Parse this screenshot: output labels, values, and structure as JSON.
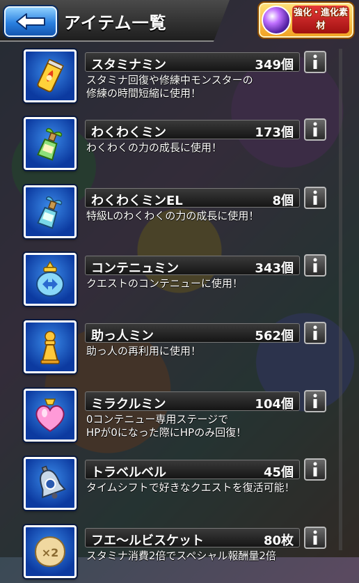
{
  "header": {
    "title": "アイテム一覧",
    "evolve_label": "強化・進化素材"
  },
  "items": [
    {
      "name": "スタミナミン",
      "count": "349個",
      "desc": "スタミナ回復や修練中モンスターの\n修練の時間短縮に使用！",
      "icon": "stamina-can-icon"
    },
    {
      "name": "わくわくミン",
      "count": "173個",
      "desc": "わくわくの力の成長に使用！",
      "icon": "sprout-bottle-icon"
    },
    {
      "name": "わくわくミンEL",
      "count": "8個",
      "desc": "特級Lのわくわくの力の成長に使用！",
      "icon": "sprout-bottle-el-icon"
    },
    {
      "name": "コンテニュミン",
      "count": "343個",
      "desc": "クエストのコンテニューに使用！",
      "icon": "continue-jar-icon"
    },
    {
      "name": "助っ人ミン",
      "count": "562個",
      "desc": "助っ人の再利用に使用！",
      "icon": "helper-pawn-icon"
    },
    {
      "name": "ミラクルミン",
      "count": "104個",
      "desc": "0コンテニュー専用ステージで\nHPが0になった際にHPのみ回復！",
      "icon": "heart-potion-icon"
    },
    {
      "name": "トラベルベル",
      "count": "45個",
      "desc": "タイムシフトで好きなクエストを復活可能！",
      "icon": "travel-bell-icon"
    },
    {
      "name": "フエ〜ルビスケット",
      "count": "80枚",
      "desc": "スタミナ消費2倍でスペシャル報酬量2倍",
      "icon": "biscuit-icon"
    }
  ]
}
